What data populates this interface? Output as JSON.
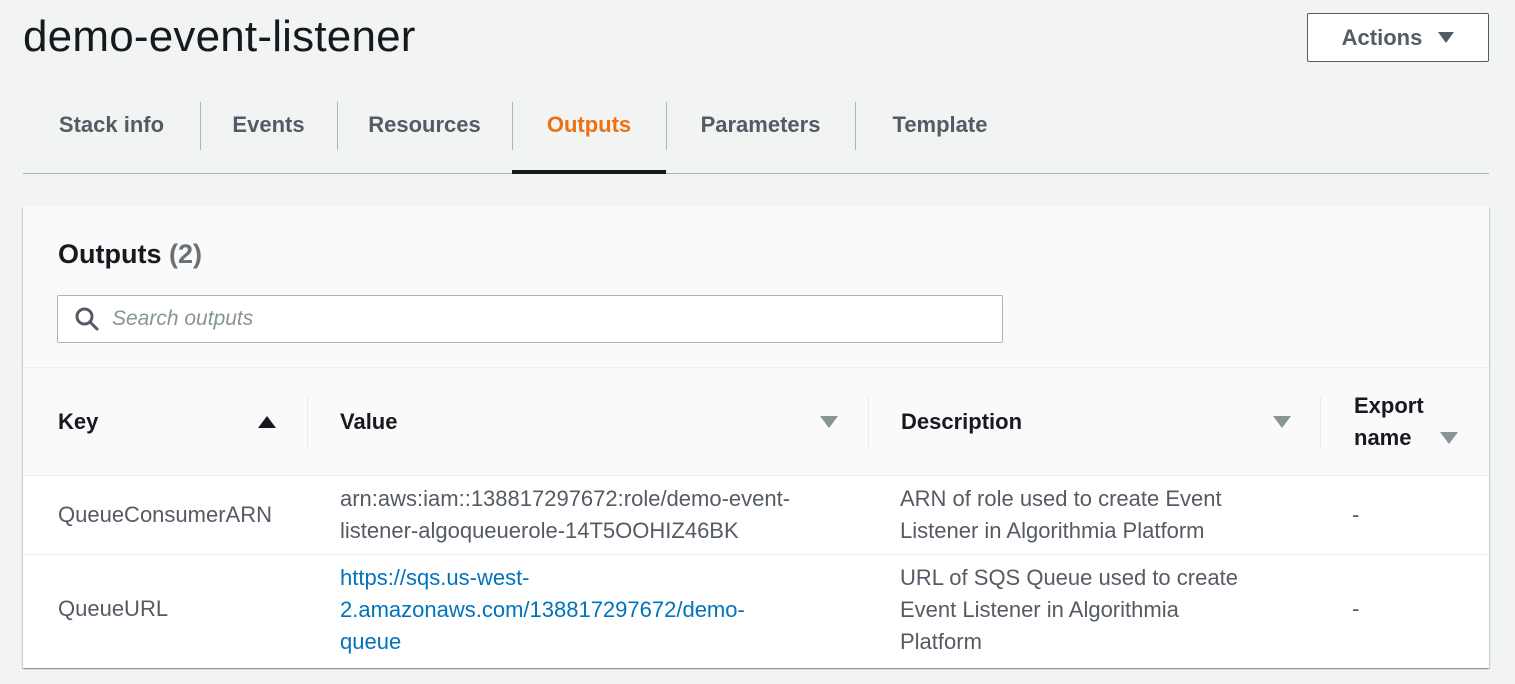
{
  "page": {
    "title": "demo-event-listener",
    "actions_label": "Actions"
  },
  "tabs": [
    {
      "label": "Stack info",
      "active": false
    },
    {
      "label": "Events",
      "active": false
    },
    {
      "label": "Resources",
      "active": false
    },
    {
      "label": "Outputs",
      "active": true
    },
    {
      "label": "Parameters",
      "active": false
    },
    {
      "label": "Template",
      "active": false
    }
  ],
  "outputs": {
    "title": "Outputs",
    "count": "(2)",
    "search_placeholder": "Search outputs",
    "search_value": "",
    "columns": {
      "key": "Key",
      "value": "Value",
      "description": "Description",
      "export_line1": "Export",
      "export_line2": "name"
    },
    "sort": {
      "column": "Key",
      "direction": "ascending"
    },
    "rows": [
      {
        "key": "QueueConsumerARN",
        "value_line1": "arn:aws:iam::138817297672:role/demo-event-",
        "value_line2": "listener-algoqueuerole-14T5OOHIZ46BK",
        "value_line3": "",
        "description_line1": "ARN of role used to create Event",
        "description_line2": "Listener in Algorithmia Platform",
        "description_line3": "",
        "export_name": "-"
      },
      {
        "key": "QueueURL",
        "value_line1": "https://sqs.us-west-",
        "value_line2": "2.amazonaws.com/138817297672/demo-",
        "value_line3": "queue",
        "description_line1": "URL of SQS Queue used to create",
        "description_line2": "Event Listener in Algorithmia",
        "description_line3": "Platform",
        "export_name": "-"
      }
    ]
  },
  "colors": {
    "active_tab": "#ec7211",
    "link": "#0073bb",
    "text": "#16191f",
    "muted": "#545b64"
  },
  "icons": [
    "chevron-down-icon",
    "search-icon",
    "sort-ascending-icon",
    "sort-descending-icon"
  ]
}
